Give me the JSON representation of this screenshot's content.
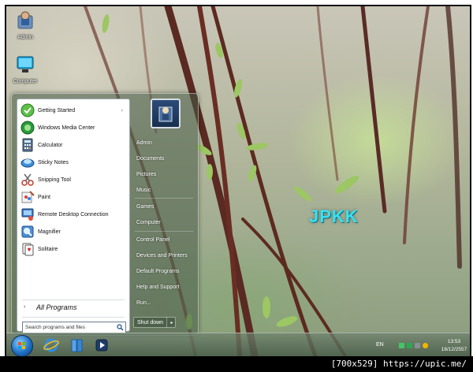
{
  "desktop": {
    "icons": [
      {
        "label": "Admin",
        "icon": "user-folder-icon"
      },
      {
        "label": "Computer",
        "icon": "computer-icon"
      }
    ],
    "watermark": "JPKK"
  },
  "start_menu": {
    "programs": [
      {
        "label": "Getting Started",
        "icon": "getting-started-icon",
        "arrow": "›"
      },
      {
        "label": "Windows Media Center",
        "icon": "media-center-icon"
      },
      {
        "label": "Calculator",
        "icon": "calculator-icon"
      },
      {
        "label": "Sticky Notes",
        "icon": "sticky-notes-icon"
      },
      {
        "label": "Snipping Tool",
        "icon": "scissors-icon"
      },
      {
        "label": "Paint",
        "icon": "paint-icon"
      },
      {
        "label": "Remote Desktop Connection",
        "icon": "remote-desktop-icon"
      },
      {
        "label": "Magnifier",
        "icon": "magnifier-icon"
      },
      {
        "label": "Solitaire",
        "icon": "solitaire-icon"
      }
    ],
    "all_programs": "All Programs",
    "all_programs_arrow": "›",
    "search_placeholder": "Search programs and files",
    "right_links": [
      "Admin",
      "Documents",
      "Pictures",
      "Music",
      "Games",
      "Computer",
      "Control Panel",
      "Devices and Printers",
      "Default Programs",
      "Help and Support",
      "Run..."
    ],
    "shutdown_label": "Shut down",
    "shutdown_arrow": "▸"
  },
  "taskbar": {
    "pinned": [
      "internet-explorer-icon",
      "file-explorer-icon",
      "media-player-icon"
    ],
    "language": "EN",
    "clock": {
      "time": "13:53",
      "date": "18/12/2557"
    }
  },
  "caption": "[700x529] https://upic.me/",
  "colors": {
    "watermark": "#39e0f0",
    "accent": "#1f6fc4"
  }
}
